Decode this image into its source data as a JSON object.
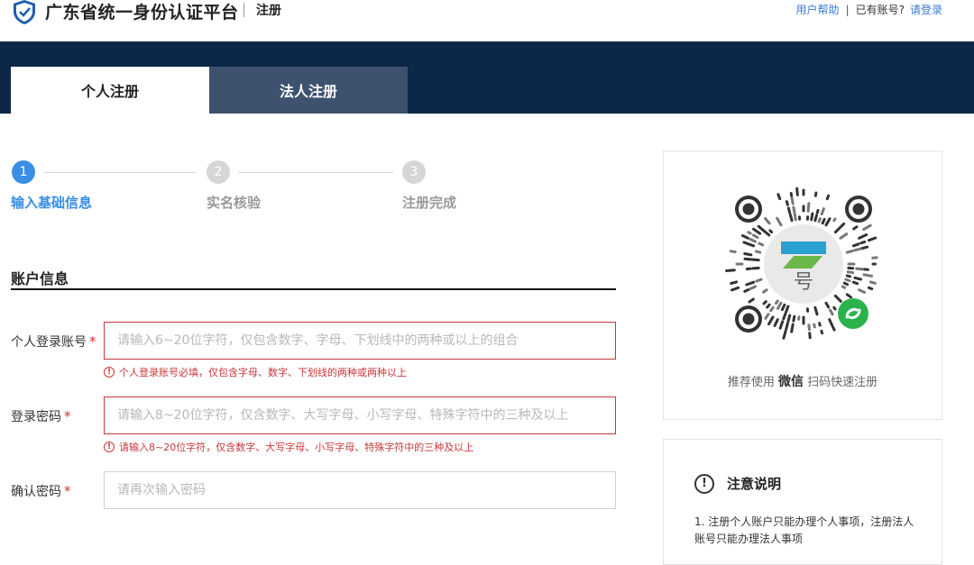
{
  "header": {
    "site_title": "广东省统一身份认证平台",
    "sub_title": "注册",
    "help_link": "用户帮助",
    "has_account_text": "已有账号?",
    "login_link": "请登录"
  },
  "tabs": [
    {
      "label": "个人注册",
      "active": true
    },
    {
      "label": "法人注册",
      "active": false
    }
  ],
  "steps": [
    {
      "number": "1",
      "label": "输入基础信息",
      "active": true
    },
    {
      "number": "2",
      "label": "实名核验",
      "active": false
    },
    {
      "number": "3",
      "label": "注册完成",
      "active": false
    }
  ],
  "section": {
    "title": "账户信息"
  },
  "form": {
    "account": {
      "label": "个人登录账号",
      "required_mark": "*",
      "placeholder": "请输入6~20位字符，仅包含数字、字母、下划线中的两种或以上的组合",
      "error": "个人登录账号必填，仅包含字母、数字、下划线的两种或两种以上"
    },
    "password": {
      "label": "登录密码",
      "required_mark": "*",
      "placeholder": "请输入8~20位字符，仅含数字、大写字母、小写字母、特殊字符中的三种及以上",
      "error": "请输入8~20位字符，仅含数字、大写字母、小写字母、特殊字符中的三种及以上"
    },
    "confirm": {
      "label": "确认密码",
      "required_mark": "*",
      "placeholder": "请再次输入密码"
    }
  },
  "qr": {
    "caption_pre": "推荐使用",
    "caption_strong": "微信",
    "caption_post": "扫码快速注册"
  },
  "notice": {
    "icon": "!",
    "title": "注意说明",
    "text": "1. 注册个人账户只能办理个人事项，注册法人账号只能办理法人事项"
  },
  "colors": {
    "banner": "#0c2747",
    "accent": "#3a8ee6",
    "error": "#c8383a"
  }
}
